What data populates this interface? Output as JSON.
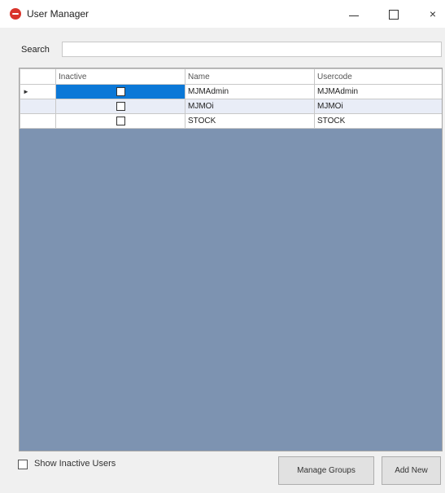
{
  "window": {
    "title": "User Manager",
    "controls": {
      "minimize": "–",
      "maximize": "☐",
      "close": "×"
    }
  },
  "search": {
    "label": "Search",
    "value": "",
    "placeholder": ""
  },
  "grid": {
    "columns": [
      "",
      "Inactive",
      "Name",
      "Usercode"
    ],
    "rows": [
      {
        "indicator": "►",
        "inactive": false,
        "name": "MJMAdmin",
        "usercode": "MJMAdmin",
        "selected": true
      },
      {
        "indicator": "",
        "inactive": false,
        "name": "MJMOi",
        "usercode": "MJMOi",
        "selected": false
      },
      {
        "indicator": "",
        "inactive": false,
        "name": "STOCK",
        "usercode": "STOCK",
        "selected": false
      }
    ],
    "empty_area_color": "#7d93b1",
    "selection_color": "#0b78d7"
  },
  "footer": {
    "show_inactive_label": "Show Inactive Users",
    "show_inactive_checked": false,
    "manage_groups_label": "Manage Groups",
    "add_new_label": "Add New"
  },
  "icons": {
    "app": "app-logo-icon",
    "row_indicator": "row-pointer-icon"
  }
}
